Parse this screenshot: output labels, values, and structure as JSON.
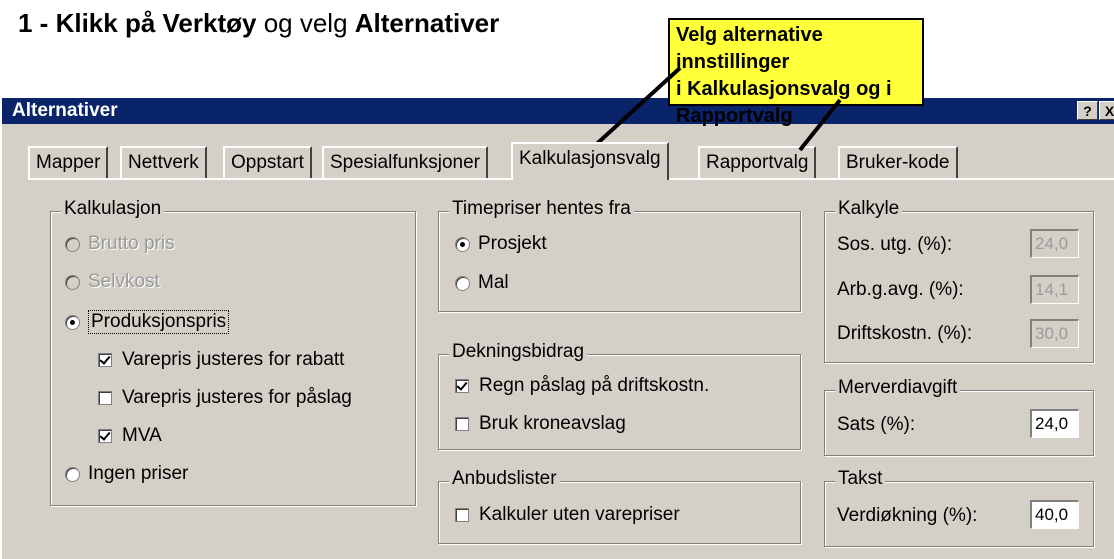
{
  "heading": {
    "prefix": "1 - ",
    "bold1": "Klikk på Verktøy",
    "mid": " og velg ",
    "bold2": "Alternativer"
  },
  "callout": {
    "line1": "Velg alternative innstillinger",
    "line2": "i Kalkulasjonsvalg og i",
    "line3": "Rapportvalg"
  },
  "window": {
    "title": "Alternativer",
    "help_label": "?",
    "close_label": "X"
  },
  "tabs": [
    {
      "label": "Mapper"
    },
    {
      "label": "Nettverk"
    },
    {
      "label": "Oppstart"
    },
    {
      "label": "Spesialfunksjoner"
    },
    {
      "label": "Kalkulasjonsvalg",
      "active": true
    },
    {
      "label": "Rapportvalg"
    },
    {
      "label": "Bruker-kode"
    }
  ],
  "kalkulasjon": {
    "title": "Kalkulasjon",
    "brutto": "Brutto pris",
    "selvkost": "Selvkost",
    "produksjonspris": "Produksjonspris",
    "varepris_rabatt": "Varepris justeres for rabatt",
    "varepris_paslag": "Varepris justeres for påslag",
    "mva": "MVA",
    "ingen": "Ingen priser"
  },
  "timepriser": {
    "title": "Timepriser hentes fra",
    "prosjekt": "Prosjekt",
    "mal": "Mal"
  },
  "dekningsbidrag": {
    "title": "Dekningsbidrag",
    "regn": "Regn påslag på driftskostn.",
    "bruk": "Bruk kroneavslag"
  },
  "anbudslister": {
    "title": "Anbudslister",
    "kalkuler": "Kalkuler uten varepriser"
  },
  "kalkyle": {
    "title": "Kalkyle",
    "sos_label": "Sos. utg. (%):",
    "sos_value": "24,0",
    "arb_label": "Arb.g.avg. (%):",
    "arb_value": "14,1",
    "drift_label": "Driftskostn. (%):",
    "drift_value": "30,0"
  },
  "merverdi": {
    "title": "Merverdiavgift",
    "sats_label": "Sats (%):",
    "sats_value": "24,0"
  },
  "takst": {
    "title": "Takst",
    "verdi_label": "Verdiøkning (%):",
    "verdi_value": "40,0"
  }
}
